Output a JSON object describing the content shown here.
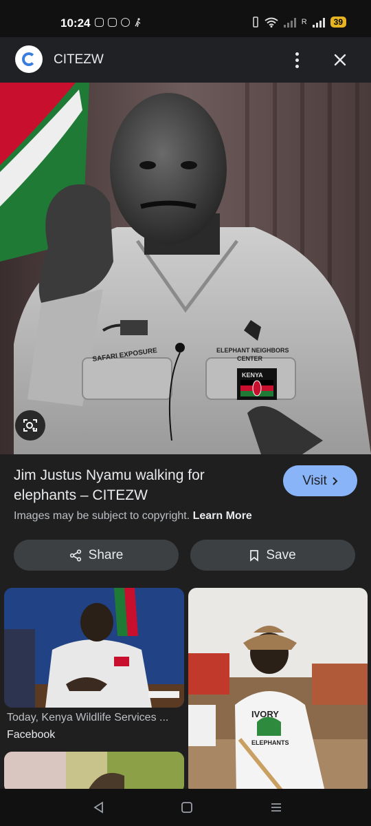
{
  "status_bar": {
    "time": "10:24",
    "network_label": "R",
    "battery": "39"
  },
  "header": {
    "site_name": "CITEZW",
    "icons": [
      "site-logo",
      "more-vert-icon",
      "close-icon"
    ]
  },
  "image": {
    "description_icons": [
      "lens-search-icon"
    ],
    "shirt_text_left": "SAFARI EXPOSURE",
    "shirt_text_right_1": "ELEPHANT NEIGHBORS",
    "shirt_text_right_2": "CENTER",
    "patch_text": "KENYA"
  },
  "result": {
    "title": "Jim Justus Nyamu walking for elephants – CITEZW",
    "visit_label": "Visit",
    "copyright_text": "Images may be subject to copyright.",
    "learn_more": "Learn More"
  },
  "actions": {
    "share_label": "Share",
    "save_label": "Save"
  },
  "related": [
    {
      "caption": "Today, Kenya Wildlife Services ...",
      "source": "Facebook"
    },
    {
      "tshirt_text_1": "IVORY",
      "tshirt_text_2": "ELEPHANTS"
    }
  ],
  "nav": {
    "icons": [
      "back-icon",
      "home-icon",
      "recents-icon"
    ]
  },
  "colors": {
    "accent": "#8ab4f8",
    "surface": "#1f1f1f",
    "pill": "#3c4043",
    "battery": "#e6b422"
  }
}
